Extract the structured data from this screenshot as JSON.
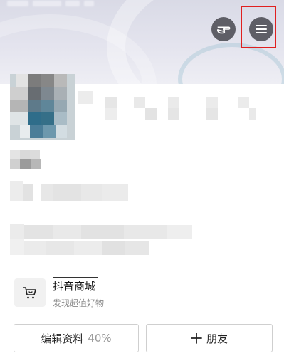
{
  "header": {
    "gesture_icon": "pointing-hand-icon",
    "menu_icon": "hamburger-menu-icon"
  },
  "shop": {
    "title": "抖音商城",
    "subtitle": "发现超值好物",
    "icon": "shopping-cart-icon"
  },
  "actions": {
    "edit_label": "编辑资料",
    "edit_progress": "40%",
    "add_friend_label": "朋友",
    "add_friend_icon": "plus-icon"
  },
  "colors": {
    "highlight": "#e02020",
    "icon_button_bg": "#5e5e66"
  }
}
